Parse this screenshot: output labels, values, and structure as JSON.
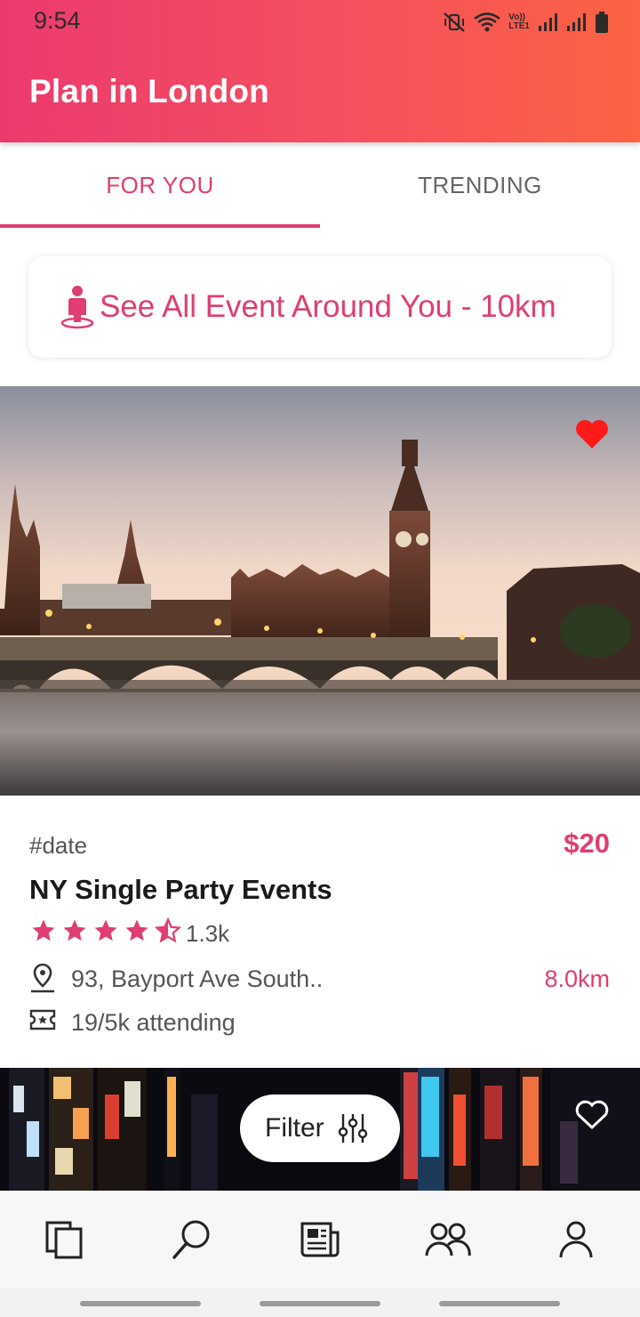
{
  "status_bar": {
    "time": "9:54",
    "network_label_top": "Vo))",
    "network_label_bottom": "LTE1",
    "icons": [
      "mute-vibrate-icon",
      "wifi-icon",
      "signal-icon",
      "signal-icon",
      "battery-icon"
    ]
  },
  "header": {
    "title": "Plan in London"
  },
  "tabs": [
    {
      "label": "FOR YOU",
      "active": true
    },
    {
      "label": "TRENDING",
      "active": false
    }
  ],
  "nearby": {
    "label": "See All Event Around You - 10km",
    "icon": "person-pin-icon"
  },
  "events": [
    {
      "tag": "#date",
      "price": "$20",
      "title": "NY Single Party Events",
      "rating": 4.5,
      "rating_count": "1.3k",
      "address": "93, Bayport Ave South..",
      "distance": "8.0km",
      "attending": "19/5k attending",
      "favorite": true
    },
    {
      "favorite": false
    }
  ],
  "filter": {
    "label": "Filter"
  },
  "bottom_nav": [
    "pages-icon",
    "search-icon",
    "news-icon",
    "friends-icon",
    "profile-icon"
  ],
  "colors": {
    "accent": "#e03d72",
    "gradient_start": "#ec3a6e",
    "gradient_end": "#fb6342",
    "heart": "#ff1a1a"
  }
}
